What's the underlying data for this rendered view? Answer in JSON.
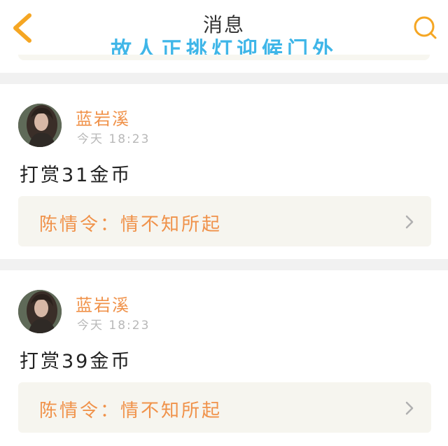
{
  "header": {
    "title": "消息",
    "overlay_caption": "故人正挑灯迎候门外",
    "back_icon": "chevron-left-icon",
    "search_icon": "search-icon",
    "accent_color": "#f5a623",
    "caption_color": "#3fb6e8"
  },
  "messages": [
    {
      "username": "蓝岩溪",
      "timestamp": "今天 18:23",
      "text": "打赏31金币",
      "quote": "陈情令：情不知所起"
    },
    {
      "username": "蓝岩溪",
      "timestamp": "今天 18:23",
      "text": "打赏39金币",
      "quote": "陈情令：情不知所起"
    }
  ],
  "colors": {
    "username": "#f0924a",
    "quote_text": "#f0924a",
    "quote_bg": "#f6f5ef",
    "timestamp": "#b8b8b8"
  }
}
